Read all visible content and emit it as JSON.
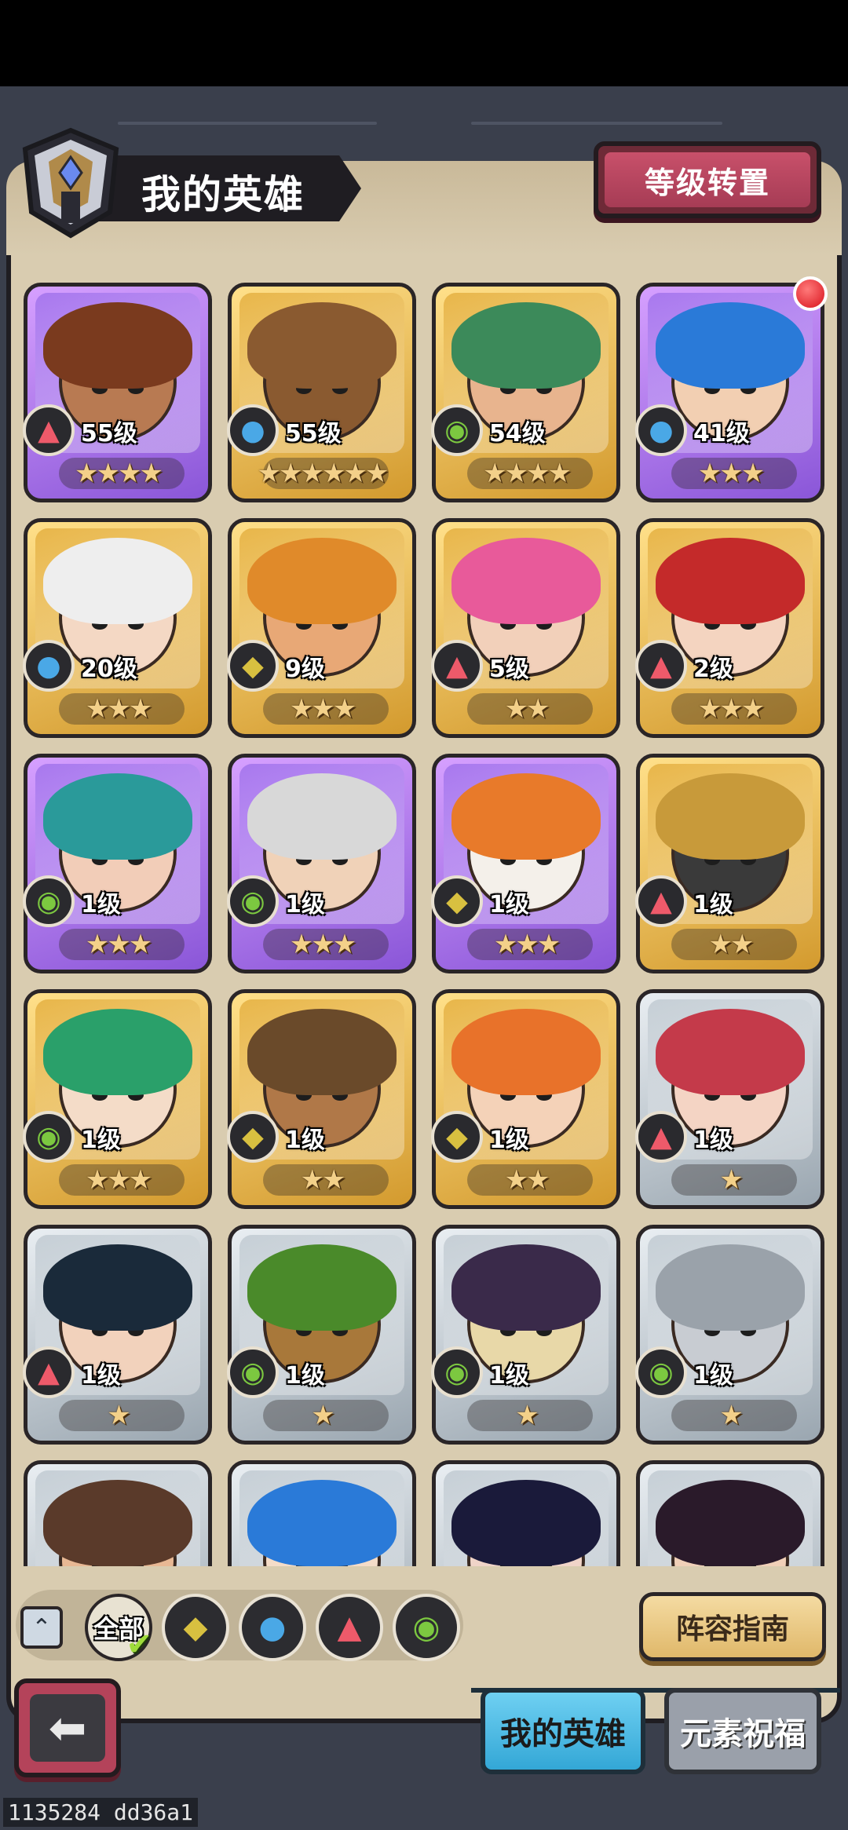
{
  "header": {
    "title": "我的英雄",
    "level_transfer_button": "等级转置",
    "helmet_icon": "helmet-icon"
  },
  "colors": {
    "panel": "#d9ccb0",
    "background": "#3a3f4c",
    "rarity": {
      "purple": "#a878ee",
      "gold": "#e8b64a",
      "silver": "#c6cfd6"
    },
    "element": {
      "fire": "#ee5a6a",
      "water": "#4aa8e6",
      "wind": "#7cc840",
      "earth": "#d8c040"
    }
  },
  "heroes": [
    {
      "level": "55级",
      "stars": "★★★★",
      "element": "fire",
      "element_icon": "fire-icon",
      "rarity": "purple",
      "hair": "#7a3a1e",
      "skin": "#b87a52"
    },
    {
      "level": "55级",
      "stars": "★★★★★★",
      "element": "water",
      "element_icon": "water-icon",
      "rarity": "gold",
      "hair": "#8a5a30",
      "skin": "#8a5a30"
    },
    {
      "level": "54级",
      "stars": "★★★★",
      "element": "wind",
      "element_icon": "wind-icon",
      "rarity": "gold",
      "hair": "#3c8a5a",
      "skin": "#e8b48e"
    },
    {
      "level": "41级",
      "stars": "★★★",
      "element": "water",
      "element_icon": "water-icon",
      "rarity": "purple",
      "hair": "#2a7ad8",
      "skin": "#f2cfb2"
    },
    {
      "level": "20级",
      "stars": "★★★",
      "element": "water",
      "element_icon": "water-icon",
      "rarity": "gold",
      "hair": "#eeeeee",
      "skin": "#f4d8c4"
    },
    {
      "level": "9级",
      "stars": "★★★",
      "element": "earth",
      "element_icon": "earth-icon",
      "rarity": "gold",
      "hair": "#e08a2a",
      "skin": "#e8a876"
    },
    {
      "level": "5级",
      "stars": "★★",
      "element": "fire",
      "element_icon": "fire-icon",
      "rarity": "gold",
      "hair": "#e85a9a",
      "skin": "#f2d0ba"
    },
    {
      "level": "2级",
      "stars": "★★★",
      "element": "fire",
      "element_icon": "fire-icon",
      "rarity": "gold",
      "hair": "#c42a2a",
      "skin": "#f4d4c0"
    },
    {
      "level": "1级",
      "stars": "★★★",
      "element": "wind",
      "element_icon": "wind-icon",
      "rarity": "purple",
      "hair": "#2a9a9a",
      "skin": "#f2cdb8"
    },
    {
      "level": "1级",
      "stars": "★★★",
      "element": "wind",
      "element_icon": "wind-icon",
      "rarity": "purple",
      "hair": "#d8d8d8",
      "skin": "#f0d2b8"
    },
    {
      "level": "1级",
      "stars": "★★★",
      "element": "earth",
      "element_icon": "earth-icon",
      "rarity": "purple",
      "hair": "#e87a2a",
      "skin": "#f4f0ea"
    },
    {
      "level": "1级",
      "stars": "★★",
      "element": "fire",
      "element_icon": "fire-icon",
      "rarity": "gold",
      "hair": "#c89a3a",
      "skin": "#3a3a3a"
    },
    {
      "level": "1级",
      "stars": "★★★",
      "element": "wind",
      "element_icon": "wind-icon",
      "rarity": "gold",
      "hair": "#2aa06a",
      "skin": "#f4dcc8"
    },
    {
      "level": "1级",
      "stars": "★★",
      "element": "earth",
      "element_icon": "earth-icon",
      "rarity": "gold",
      "hair": "#6a4a2a",
      "skin": "#b07848"
    },
    {
      "level": "1级",
      "stars": "★★",
      "element": "earth",
      "element_icon": "earth-icon",
      "rarity": "gold",
      "hair": "#e8722a",
      "skin": "#f4d2b8"
    },
    {
      "level": "1级",
      "stars": "★",
      "element": "fire",
      "element_icon": "fire-icon",
      "rarity": "silver",
      "hair": "#c43a4a",
      "skin": "#f4d4c4"
    },
    {
      "level": "1级",
      "stars": "★",
      "element": "fire",
      "element_icon": "fire-icon",
      "rarity": "silver",
      "hair": "#1a2a3a",
      "skin": "#f2d2bc"
    },
    {
      "level": "1级",
      "stars": "★",
      "element": "wind",
      "element_icon": "wind-icon",
      "rarity": "silver",
      "hair": "#4a8a2a",
      "skin": "#a8783a"
    },
    {
      "level": "1级",
      "stars": "★",
      "element": "wind",
      "element_icon": "wind-icon",
      "rarity": "silver",
      "hair": "#3a2a4a",
      "skin": "#e8d8a8"
    },
    {
      "level": "1级",
      "stars": "★",
      "element": "wind",
      "element_icon": "wind-icon",
      "rarity": "silver",
      "hair": "#9aa2aa",
      "skin": "#c8ccd2"
    },
    {
      "level": "",
      "stars": "",
      "element": "",
      "element_icon": "",
      "rarity": "silver",
      "hair": "#5a3a2a",
      "skin": "#e8b894"
    },
    {
      "level": "",
      "stars": "",
      "element": "",
      "element_icon": "",
      "rarity": "silver",
      "hair": "#2a7ad8",
      "skin": "#f4dcc8"
    },
    {
      "level": "",
      "stars": "",
      "element": "",
      "element_icon": "",
      "rarity": "silver",
      "hair": "#1a1a3a",
      "skin": "#f0d4c8"
    },
    {
      "level": "",
      "stars": "",
      "element": "",
      "element_icon": "",
      "rarity": "silver",
      "hair": "#2a1a2a",
      "skin": "#f0d0b8"
    }
  ],
  "filters": {
    "collapse_icon": "chevron-up-icon",
    "all_label": "全部",
    "check_icon": "check-icon",
    "elements": [
      {
        "icon": "earth-icon",
        "glyph": "◆",
        "color": "#d8c040"
      },
      {
        "icon": "water-icon",
        "glyph": "●",
        "color": "#4aa8e6"
      },
      {
        "icon": "fire-icon",
        "glyph": "▲",
        "color": "#ee5a6a"
      },
      {
        "icon": "wind-icon",
        "glyph": "◉",
        "color": "#7cc840"
      }
    ]
  },
  "lineup_guide_button": "阵容指南",
  "back_icon": "back-arrow-icon",
  "tabs": {
    "my_heroes": "我的英雄",
    "element_blessing": "元素祝福"
  },
  "watermark": "1135284 dd36a1"
}
